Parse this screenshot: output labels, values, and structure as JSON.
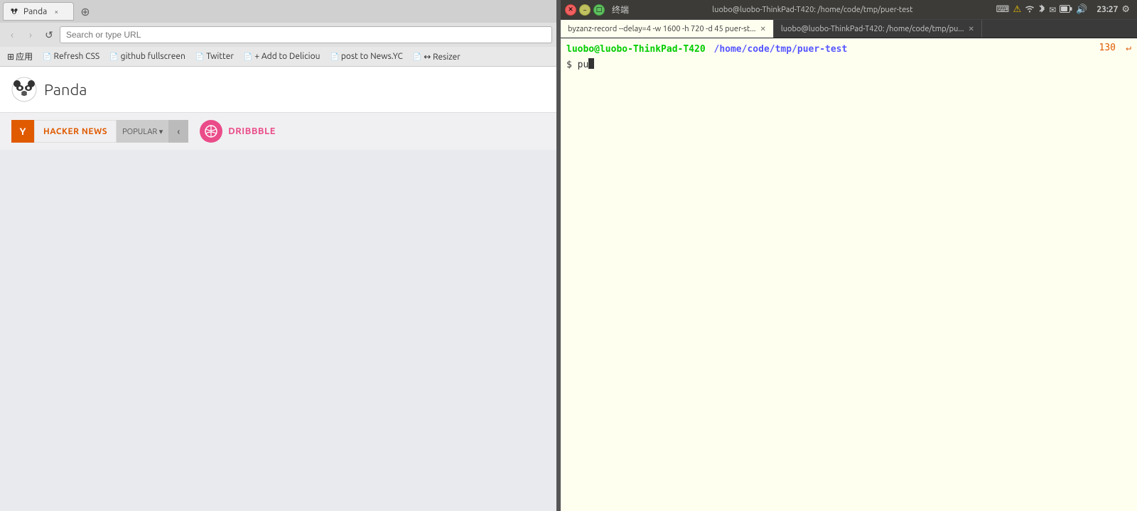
{
  "browser": {
    "tab": {
      "label": "Panda",
      "close_label": "×"
    },
    "new_tab_label": "+",
    "nav": {
      "back_label": "‹",
      "forward_label": "›",
      "reload_label": "↺",
      "address_value": ""
    },
    "bookmarks": [
      {
        "id": "apps",
        "label": "应用",
        "icon": "⊞"
      },
      {
        "id": "refresh-css",
        "label": "Refresh CSS",
        "icon": "📄"
      },
      {
        "id": "github-fullscreen",
        "label": "github fullscreen",
        "icon": "📄"
      },
      {
        "id": "twitter",
        "label": "Twitter",
        "icon": "📄"
      },
      {
        "id": "add-delicious",
        "label": "+ Add to Deliciou",
        "icon": "📄"
      },
      {
        "id": "post-newsyc",
        "label": "post to News.YC",
        "icon": "📄"
      },
      {
        "id": "resizer",
        "label": "↔ Resizer",
        "icon": "📄"
      }
    ],
    "panda": {
      "title": "Panda",
      "sections": [
        {
          "id": "hacker-news",
          "badge": "Y",
          "label": "HACKER NEWS",
          "has_popular": true,
          "popular_label": "POPULAR ▾",
          "has_arrow": true
        },
        {
          "id": "dribbble",
          "label": "DRIBBBLE"
        }
      ]
    }
  },
  "terminal": {
    "app_title": "终端",
    "title_bar_text": "luobo@luobo-ThinkPad-T420: /home/code/tmp/puer-test",
    "tabs": [
      {
        "id": "tab1",
        "label": "byzanz-record --delay=4 -w 1600 -h 720 -d 45 puer-st...",
        "active": true
      },
      {
        "id": "tab2",
        "label": "luobo@luobo-ThinkPad-T420: /home/code/tmp/pu...",
        "active": false
      }
    ],
    "prompt": {
      "user_host": "luobo@luobo-ThinkPad-T420",
      "path": "/home/code/tmp/puer-test",
      "command": "pu"
    },
    "line_number": "130",
    "return_arrow": "↵",
    "cursor": ""
  },
  "system_tray": {
    "time": "23:27",
    "icons": [
      "keyboard",
      "warning",
      "wifi",
      "bluetooth",
      "mail",
      "battery",
      "volume",
      "settings"
    ]
  }
}
